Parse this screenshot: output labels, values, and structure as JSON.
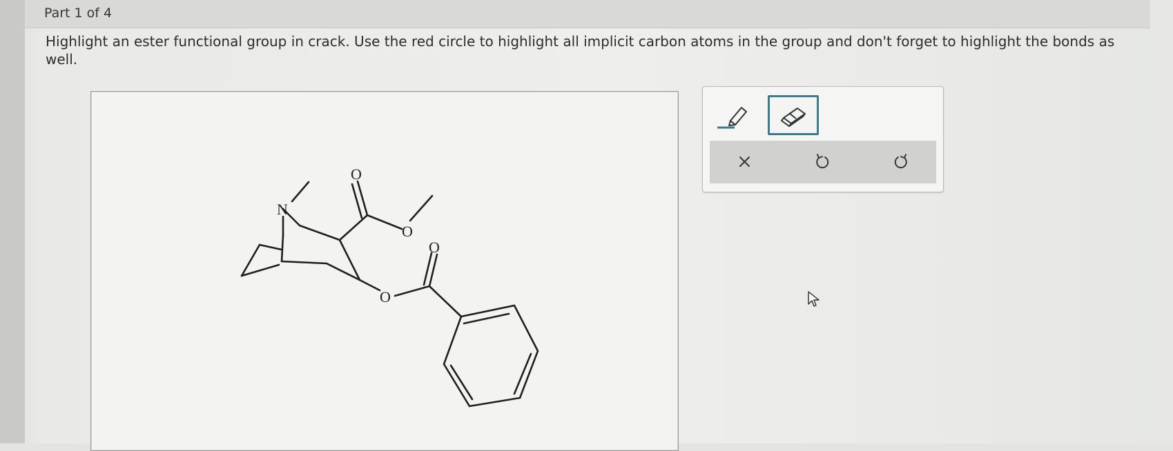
{
  "part": {
    "label": "Part 1 of 4"
  },
  "question": {
    "text": "Highlight an ester functional group in crack. Use the red circle to highlight all implicit carbon atoms in the group and don't forget to highlight the bonds as well."
  },
  "molecule": {
    "atoms": {
      "n": "N",
      "o_carbonyl_1": "O",
      "o_ether_1": "O",
      "o_carbonyl_2": "O",
      "o_ether_2": "O"
    }
  },
  "toolbox": {
    "selected_tool": "eraser",
    "tools": [
      {
        "name": "highlighter",
        "icon": "highlighter-icon",
        "selected": false
      },
      {
        "name": "eraser",
        "icon": "eraser-icon",
        "selected": true
      }
    ],
    "actions": [
      {
        "name": "clear",
        "icon": "x-icon"
      },
      {
        "name": "undo",
        "icon": "undo-icon"
      },
      {
        "name": "redo",
        "icon": "redo-icon"
      }
    ],
    "accent_color": "#3c7a8c"
  }
}
